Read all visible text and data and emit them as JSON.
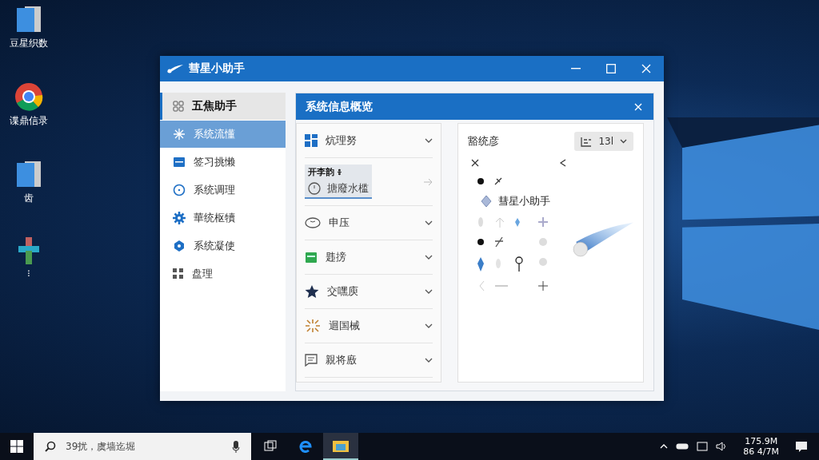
{
  "desktop": {
    "icons": [
      {
        "label": "豆星织数"
      },
      {
        "label": "谍鼎信录"
      },
      {
        "label": "齿"
      },
      {
        "label": "⁝"
      }
    ]
  },
  "window": {
    "title": "彗星小助手",
    "sidebar": {
      "items": [
        {
          "label": "五焦助手",
          "kind": "header",
          "selected": false
        },
        {
          "label": "系统流懂",
          "kind": "item",
          "selected": true
        },
        {
          "label": "签习挑懒",
          "kind": "item",
          "selected": false
        },
        {
          "label": "系统调理",
          "kind": "item",
          "selected": false
        },
        {
          "label": "華统枢犢",
          "kind": "item",
          "selected": false
        },
        {
          "label": "系统凝使",
          "kind": "item",
          "selected": false
        },
        {
          "label": "盘理",
          "kind": "item",
          "selected": false
        }
      ]
    },
    "panel": {
      "title": "系统信息概览",
      "list": [
        {
          "label": "炕理努",
          "kind": "row"
        },
        {
          "label": "搪廢水槛",
          "caption": "开李韵 ៖",
          "kind": "card"
        },
        {
          "label": "申压",
          "kind": "row"
        },
        {
          "label": "韪搒",
          "kind": "row"
        },
        {
          "label": "交嘿庾",
          "kind": "row"
        },
        {
          "label": "迴国械",
          "kind": "row"
        },
        {
          "label": "親将廒",
          "kind": "row"
        }
      ],
      "preview": {
        "title": "豁统彦",
        "dropdown": "13l",
        "grid_label": "彗星小助手"
      }
    }
  },
  "taskbar": {
    "search": {
      "placeholder": "39扰，虞墙迄堀"
    },
    "apps": [
      {
        "selected": false
      },
      {
        "selected": false
      },
      {
        "selected": true
      }
    ],
    "time": "175.9M",
    "date": "86 4/7M"
  }
}
